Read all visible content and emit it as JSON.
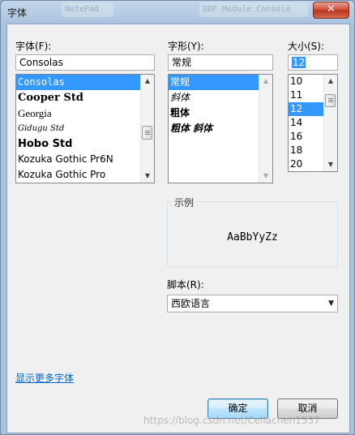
{
  "window": {
    "title": "字体",
    "close_glyph": "✕",
    "background_title_1": "NotePad",
    "background_title_2": "DBF Module Console"
  },
  "font": {
    "label": "字体(F):",
    "value": "Consolas",
    "items": [
      {
        "label": "Consolas",
        "selected": true
      },
      {
        "label": "Cooper Std",
        "selected": false
      },
      {
        "label": "Georgia",
        "selected": false
      },
      {
        "label": "Gidugu Std",
        "selected": false
      },
      {
        "label": "Hobo Std",
        "selected": false
      },
      {
        "label": "Kozuka Gothic Pr6N",
        "selected": false
      },
      {
        "label": "Kozuka Gothic Pro",
        "selected": false
      }
    ]
  },
  "style": {
    "label": "字形(Y):",
    "value": "常规",
    "items": [
      {
        "label": "常规",
        "selected": true
      },
      {
        "label": "斜体",
        "selected": false
      },
      {
        "label": "粗体",
        "selected": false
      },
      {
        "label": "粗体 斜体",
        "selected": false
      }
    ]
  },
  "size": {
    "label": "大小(S):",
    "value": "12",
    "items": [
      {
        "label": "10",
        "selected": false
      },
      {
        "label": "11",
        "selected": false
      },
      {
        "label": "12",
        "selected": true
      },
      {
        "label": "14",
        "selected": false
      },
      {
        "label": "16",
        "selected": false
      },
      {
        "label": "18",
        "selected": false
      },
      {
        "label": "20",
        "selected": false
      }
    ]
  },
  "sample": {
    "legend": "示例",
    "text": "AaBbYyZz"
  },
  "script": {
    "label": "脚本(R):",
    "value": "西欧语言"
  },
  "more_fonts_link": "显示更多字体",
  "buttons": {
    "ok": "确定",
    "cancel": "取消"
  },
  "watermark": "https://blog.csdn.net/Cellachen1537",
  "colors": {
    "selection": "#3399ff",
    "link": "#0066cc",
    "close_button": "#c7432c",
    "default_button_border": "#3c7fb1"
  },
  "icons": {
    "close": "close-icon",
    "scroll_up": "scroll-up-arrow-icon",
    "scroll_down": "scroll-down-arrow-icon",
    "dropdown": "chevron-down-icon"
  }
}
